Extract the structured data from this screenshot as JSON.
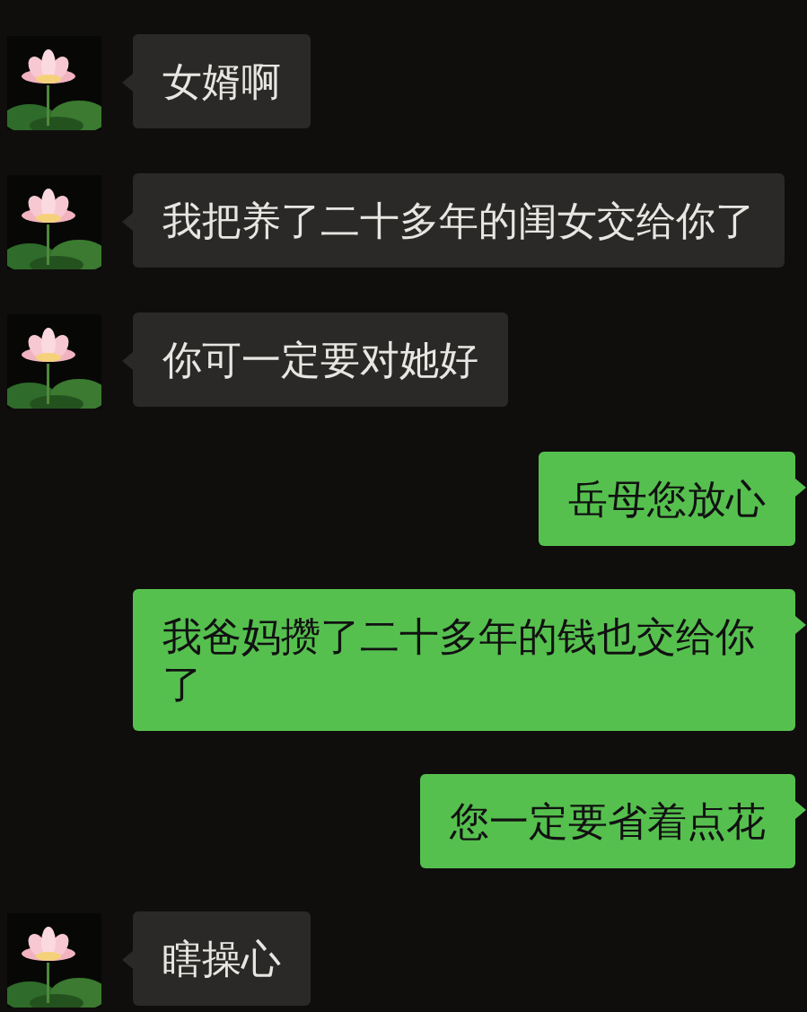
{
  "messages": [
    {
      "kind": "incoming",
      "text": "女婿啊"
    },
    {
      "kind": "incoming",
      "text": "我把养了二十多年的闺女交给你了"
    },
    {
      "kind": "incoming",
      "text": "你可一定要对她好"
    },
    {
      "kind": "outgoing",
      "text": "岳母您放心"
    },
    {
      "kind": "outgoing",
      "text": "我爸妈攒了二十多年的钱也交给你了"
    },
    {
      "kind": "outgoing",
      "text": "您一定要省着点花"
    },
    {
      "kind": "incoming",
      "text": "瞎操心"
    }
  ]
}
